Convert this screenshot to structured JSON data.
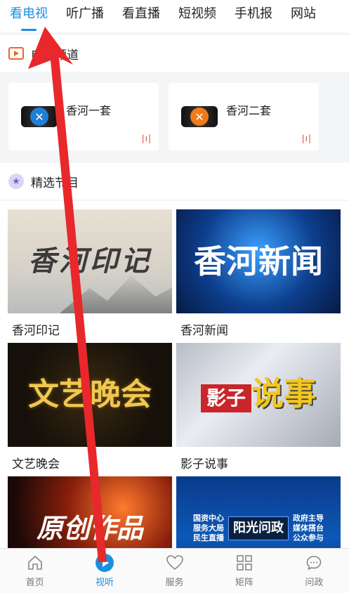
{
  "top_tabs": [
    "看电视",
    "听广播",
    "看直播",
    "短视频",
    "手机报",
    "网站"
  ],
  "channels_section": {
    "title": "电视频道",
    "icon": "tv-play-icon"
  },
  "channels": [
    {
      "name": "香河一套",
      "logo_color": "#1f7fd6"
    },
    {
      "name": "香河二套",
      "logo_color": "#f07a1a"
    }
  ],
  "programs_section": {
    "title": "精选节目",
    "icon": "star-icon"
  },
  "programs": [
    {
      "title": "香河印记",
      "overlay": "香河印记"
    },
    {
      "title": "香河新闻",
      "overlay": "香河新闻"
    },
    {
      "title": "文艺晚会",
      "overlay": "文艺晚会"
    },
    {
      "title": "影子说事",
      "overlay_a": "影子",
      "overlay_b": "说事"
    },
    {
      "title": "",
      "overlay": "原创作品"
    },
    {
      "title": "",
      "overlay_lines": [
        "国资中心",
        "服务大局",
        "民生直播"
      ],
      "overlay_center": "阳光问政",
      "overlay_right": [
        "政府主导",
        "媒体搭台",
        "公众参与"
      ]
    }
  ],
  "bottom_nav": [
    {
      "label": "首页",
      "icon": "home-icon"
    },
    {
      "label": "视听",
      "icon": "play-icon"
    },
    {
      "label": "服务",
      "icon": "heart-icon"
    },
    {
      "label": "矩阵",
      "icon": "grid-icon"
    },
    {
      "label": "问政",
      "icon": "chat-icon"
    }
  ],
  "colors": {
    "accent": "#1a8fe0",
    "live": "#e0443a",
    "arrow": "#e8282b"
  }
}
